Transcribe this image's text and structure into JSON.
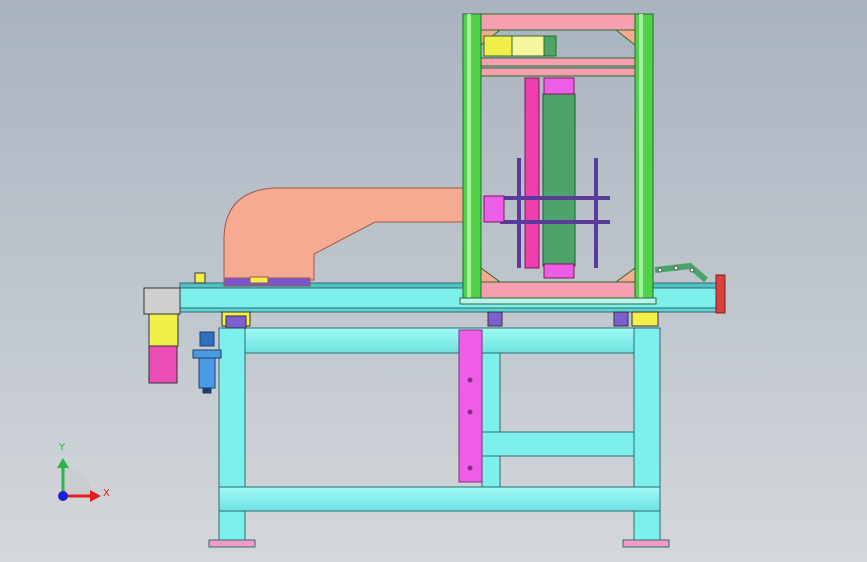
{
  "viewport": {
    "background_top": "#a9b3bf",
    "background_bottom": "#d4d8dc"
  },
  "model": {
    "parts": [
      "frame-table",
      "conveyor-beam",
      "duct-elbow",
      "vertical-tower",
      "chain-assembly",
      "motor",
      "air-filter-regulator",
      "cable-carrier"
    ]
  },
  "triad": {
    "y_label": "Y",
    "x_label": "X",
    "y_color": "#2fb34a",
    "x_color": "#e02020",
    "z_color": "#1a22d6"
  },
  "colors": {
    "frame": "#7ef0ec",
    "frame_dark": "#3aa3a6",
    "salmon": "#f7aa92",
    "tower_green": "#4fd14a",
    "magenta": "#ee5de6",
    "purple": "#6a4fb0",
    "yellow": "#f2ee4a",
    "pink": "#f084c8",
    "chain_green": "#4ca46a"
  }
}
